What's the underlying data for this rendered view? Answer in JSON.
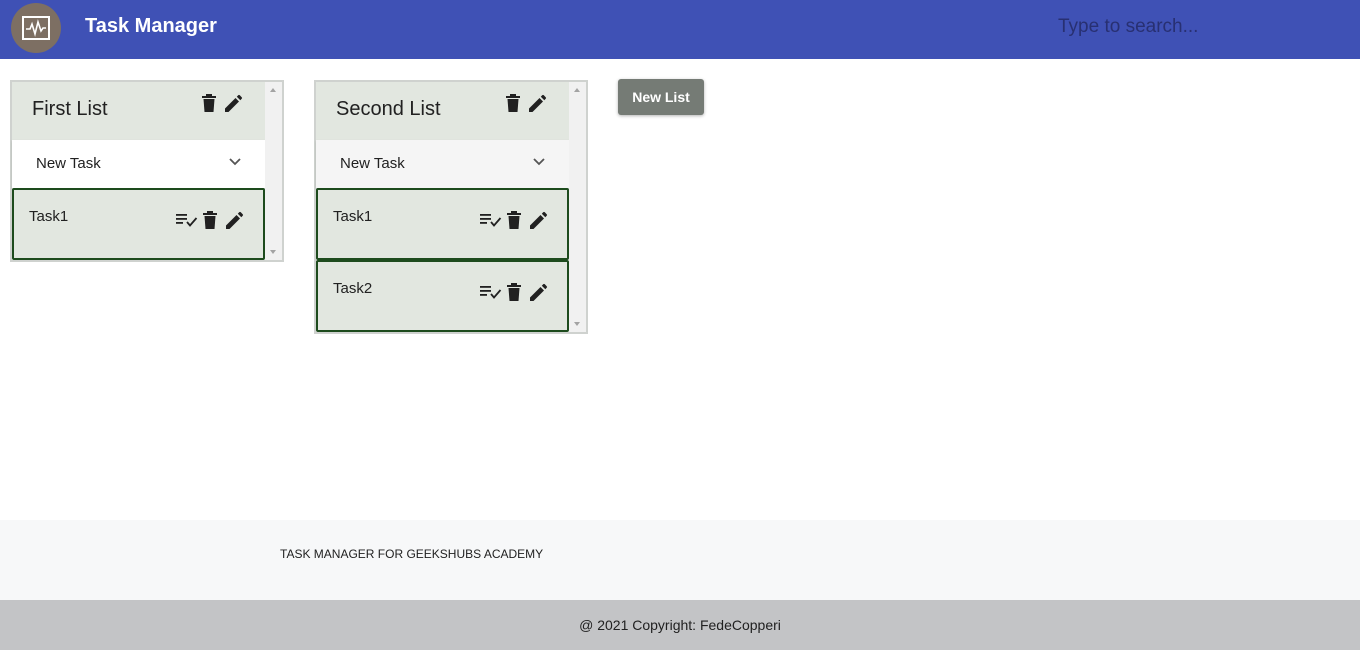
{
  "header": {
    "title": "Task Manager",
    "search_placeholder": "Type to search..."
  },
  "lists": [
    {
      "title": "First List",
      "new_task_label": "New Task",
      "tasks": [
        "Task1"
      ]
    },
    {
      "title": "Second List",
      "new_task_label": "New Task",
      "tasks": [
        "Task1",
        "Task2"
      ]
    }
  ],
  "new_list_button": "New List",
  "footer": {
    "text": "TASK MANAGER FOR GEEKSHUBS ACADEMY",
    "copyright": "@ 2021 Copyright: FedeCopperi"
  },
  "colors": {
    "header_bg": "#3f51b5",
    "task_border": "#1d4b1d",
    "card_bg": "#e2e7e0",
    "button_bg": "#757b75"
  },
  "icons": [
    "activity-monitor-icon",
    "trash-icon",
    "edit-icon",
    "chevron-down-icon",
    "playlist-check-icon"
  ]
}
